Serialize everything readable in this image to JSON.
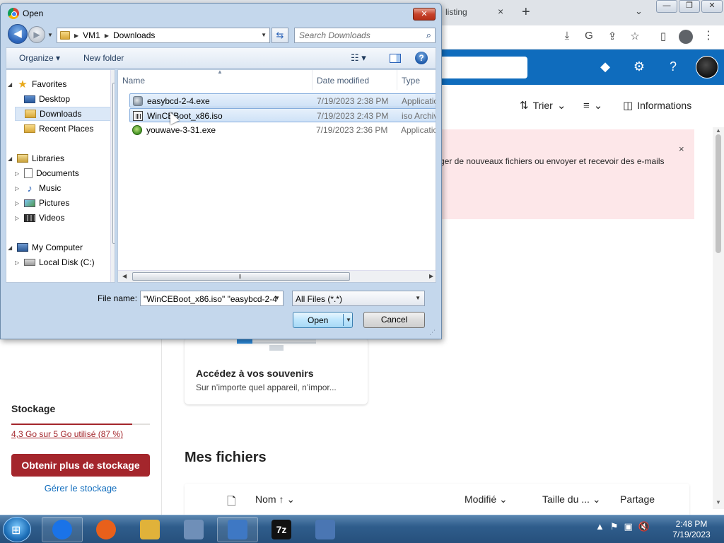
{
  "browser": {
    "tab_fragment": "listing",
    "tab_close": "×",
    "new_tab": "+",
    "tab_search": "⌄",
    "window_buttons": [
      "—",
      "❐",
      "✕"
    ],
    "address_icons": [
      "⤓",
      "G",
      "⇪",
      "☆",
      "▯"
    ],
    "menu": "⋮"
  },
  "onedrive": {
    "header_icons": [
      "◆",
      "⚙",
      "?"
    ],
    "commands": {
      "sort_icon": "⇅",
      "sort_label": "Trier",
      "sort_chevron": "⌄",
      "view_icon": "≡",
      "view_chevron": "⌄",
      "info_icon": "◫",
      "info_label": "Informations"
    },
    "notice": {
      "text": "ger de nouveaux fichiers ou envoyer et recevoir des e-mails",
      "close": "×"
    },
    "card": {
      "title": "Accédez à vos souvenirs",
      "subtitle": "Sur n’importe quel appareil, n’impor..."
    },
    "storage": {
      "heading": "Stockage",
      "usage_text": "4,3 Go sur 5 Go utilisé (87 %)",
      "usage_fraction": 0.87,
      "button": "Obtenir plus de stockage",
      "manage_link": "Gérer le stockage"
    },
    "files": {
      "heading": "Mes fichiers",
      "col_name": "Nom ↑ ⌄",
      "col_modified": "Modifié ⌄",
      "col_size": "Taille du ... ⌄",
      "col_share": "Partage"
    },
    "accent_color": "#0f6cbd",
    "storage_color": "#a4262c"
  },
  "dialog": {
    "title": "Open",
    "close": "✕",
    "back": "◀",
    "forward": "▶",
    "history_drop": "▼",
    "breadcrumb": [
      "VM1",
      "Downloads"
    ],
    "breadcrumb_arrow": "▶",
    "breadcrumb_drop": "▼",
    "refresh": "⇆",
    "search_placeholder": "Search Downloads",
    "search_icon": "⌕",
    "toolbar": {
      "organize": "Organize ▾",
      "new_folder": "New folder",
      "views": "☷ ▾",
      "help": "?"
    },
    "nav": [
      {
        "label": "Favorites",
        "icon": "star-icon",
        "expander": "◢"
      },
      {
        "label": "Desktop",
        "icon": "desktop-icon",
        "expander": ""
      },
      {
        "label": "Downloads",
        "icon": "folder-icon",
        "expander": "",
        "selected": true
      },
      {
        "label": "Recent Places",
        "icon": "recent-places-icon",
        "expander": ""
      },
      {
        "label": "Libraries",
        "icon": "library-icon",
        "expander": "◢"
      },
      {
        "label": "Documents",
        "icon": "document-icon",
        "expander": "▷"
      },
      {
        "label": "Music",
        "icon": "music-icon",
        "expander": "▷"
      },
      {
        "label": "Pictures",
        "icon": "pictures-icon",
        "expander": "▷"
      },
      {
        "label": "Videos",
        "icon": "videos-icon",
        "expander": "▷"
      },
      {
        "label": "My Computer",
        "icon": "computer-icon",
        "expander": "◢"
      },
      {
        "label": "Local Disk (C:)",
        "icon": "disk-icon",
        "expander": "▷"
      }
    ],
    "columns": {
      "name": "Name",
      "date": "Date modified",
      "type": "Type"
    },
    "files": [
      {
        "name": "easybcd-2-4.exe",
        "date": "7/19/2023 2:38 PM",
        "type": "Applicatio",
        "icon": "exe-icon",
        "selected": true
      },
      {
        "name": "WinCEBoot_x86.iso",
        "date": "7/19/2023 2:43 PM",
        "type": "iso Archiv",
        "icon": "iso-icon",
        "selected": true
      },
      {
        "name": "youwave-3-31.exe",
        "date": "7/19/2023 2:36 PM",
        "type": "Applicatio",
        "icon": "apk-exe-icon",
        "selected": false
      }
    ],
    "filename_label": "File name:",
    "filename_value": "\"WinCEBoot_x86.iso\" \"easybcd-2-4",
    "filetype_value": "All Files (*.*)",
    "open_button": "Open",
    "cancel_button": "Cancel",
    "dropdown_arrow": "▼"
  },
  "taskbar": {
    "start": "⊞",
    "apps": [
      {
        "name": "chrome",
        "glyph": "",
        "color": "#1a73e8",
        "active": true
      },
      {
        "name": "firefox",
        "glyph": "",
        "color": "#e8601b",
        "active": false
      },
      {
        "name": "explorer",
        "glyph": "",
        "color": "#e0b23a",
        "active": false
      },
      {
        "name": "network",
        "glyph": "",
        "color": "#6f8fb8",
        "active": false
      },
      {
        "name": "control-panel",
        "glyph": "",
        "color": "#3e78c4",
        "active": true
      },
      {
        "name": "7zip",
        "glyph": "7z",
        "color": "#111111",
        "active": false
      },
      {
        "name": "keyboard",
        "glyph": "",
        "color": "#4a76b3",
        "active": false
      }
    ],
    "tray_icons": [
      "▲",
      "⚑",
      "▣",
      "🔇"
    ],
    "time": "2:48 PM",
    "date": "7/19/2023"
  }
}
